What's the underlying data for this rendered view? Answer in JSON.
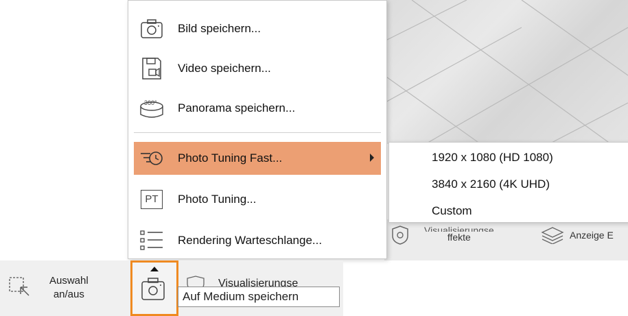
{
  "menu": {
    "items": [
      {
        "icon": "camera-icon",
        "label": "Bild speichern..."
      },
      {
        "icon": "floppy-video-icon",
        "label": "Video speichern..."
      },
      {
        "icon": "panorama-360-icon",
        "label": "Panorama speichern..."
      },
      {
        "icon": "photo-tuning-fast-icon",
        "label": "Photo Tuning Fast...",
        "active": true,
        "has_submenu": true
      },
      {
        "icon": "pt-icon",
        "label": "Photo Tuning..."
      },
      {
        "icon": "list-icon",
        "label": "Rendering Warteschlange..."
      }
    ],
    "pt_icon_text": "PT",
    "panorama_icon_text": "360°"
  },
  "submenu": {
    "items": [
      "1920 x 1080 (HD 1080)",
      "3840 x 2160 (4K UHD)",
      "Custom"
    ]
  },
  "background": {
    "visual_effects_label_a": "Visualisierungse",
    "visual_effects_label_b": "ffekte",
    "display_label": "Anzeige E"
  },
  "toolbar": {
    "selection_label_1": "Auswahl",
    "selection_label_2": "an/aus",
    "visual_effects_label": "Visualisierungse",
    "tooltip": "Auf Medium speichern"
  },
  "colors": {
    "active_item": "#ec9f73",
    "highlight_border": "#ef8a21"
  }
}
